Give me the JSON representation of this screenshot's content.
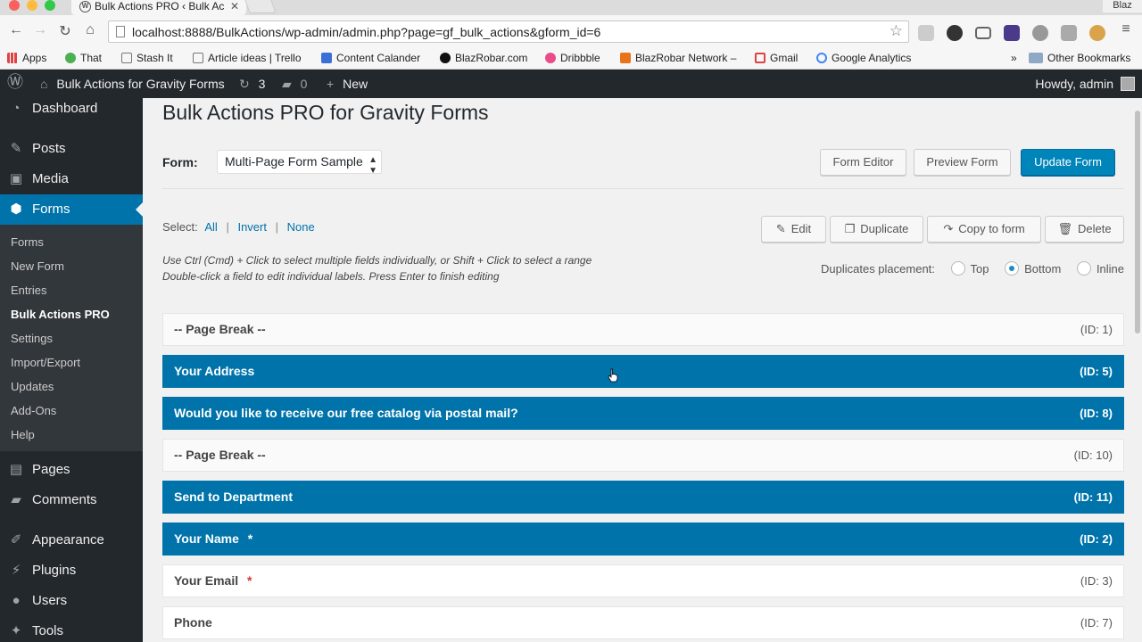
{
  "browser": {
    "tab_title": "Bulk Actions PRO ‹ Bulk Ac",
    "profile": "Blaz",
    "url": "localhost:8888/BulkActions/wp-admin/admin.php?page=gf_bulk_actions&gform_id=6",
    "bookmarks": [
      "Apps",
      "That",
      "Stash It",
      "Article ideas | Trello",
      "Content Calander",
      "BlazRobar.com",
      "Dribbble",
      "BlazRobar Network –",
      "Gmail",
      "Google Analytics"
    ],
    "other_bookmarks": "Other Bookmarks"
  },
  "adminbar": {
    "site_name": "Bulk Actions for Gravity Forms",
    "updates_count": "3",
    "comments_count": "0",
    "new_label": "New",
    "howdy": "Howdy, admin"
  },
  "sidebar": {
    "items": [
      "Dashboard",
      "Posts",
      "Media",
      "Forms",
      "Pages",
      "Comments",
      "Appearance",
      "Plugins",
      "Users",
      "Tools"
    ],
    "submenu": [
      "Forms",
      "New Form",
      "Entries",
      "Bulk Actions PRO",
      "Settings",
      "Import/Export",
      "Updates",
      "Add-Ons",
      "Help"
    ]
  },
  "main": {
    "title": "Bulk Actions PRO for Gravity Forms",
    "form_label": "Form:",
    "form_select": "Multi-Page Form Sample",
    "form_editor": "Form Editor",
    "preview_form": "Preview Form",
    "update_form": "Update Form",
    "select_label": "Select:",
    "select_all": "All",
    "select_invert": "Invert",
    "select_none": "None",
    "edit": "Edit",
    "duplicate": "Duplicate",
    "copy_to_form": "Copy to form",
    "delete": "Delete",
    "help_line1": "Use Ctrl (Cmd) + Click to select multiple fields individually, or Shift + Click to select a range",
    "help_line2": "Double-click a field to edit individual labels. Press Enter to finish editing",
    "placement_label": "Duplicates placement:",
    "placement_top": "Top",
    "placement_bottom": "Bottom",
    "placement_inline": "Inline",
    "fields": [
      {
        "label": "-- Page Break --",
        "id": "(ID: 1)",
        "selected": false,
        "required": false
      },
      {
        "label": "Your Address",
        "id": "(ID: 5)",
        "selected": true,
        "required": false
      },
      {
        "label": "Would you like to receive our free catalog via postal mail?",
        "id": "(ID: 8)",
        "selected": true,
        "required": false
      },
      {
        "label": "-- Page Break --",
        "id": "(ID: 10)",
        "selected": false,
        "required": false
      },
      {
        "label": "Send to Department",
        "id": "(ID: 11)",
        "selected": true,
        "required": false
      },
      {
        "label": "Your Name",
        "id": "(ID: 2)",
        "selected": true,
        "required": true
      },
      {
        "label": "Your Email",
        "id": "(ID: 3)",
        "selected": false,
        "required": true
      },
      {
        "label": "Phone",
        "id": "(ID: 7)",
        "selected": false,
        "required": false
      }
    ],
    "required_mark": "*"
  }
}
